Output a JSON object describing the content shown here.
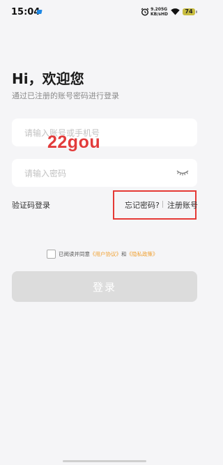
{
  "status_bar": {
    "time": "15:04",
    "net_speed_value": "9.20",
    "net_speed_unit": "KB/s",
    "net_type_top": "5G",
    "net_type_bottom": "HD",
    "battery": "74",
    "battery_color": "#c7bc40",
    "icons": [
      "app-notification-icon",
      "alarm-icon",
      "wifi-icon",
      "battery-icon"
    ]
  },
  "header": {
    "title": "Hi，欢迎您",
    "subtitle": "通过已注册的账号密码进行登录"
  },
  "form": {
    "account_placeholder": "请输入账号或手机号",
    "account_value": "",
    "password_placeholder": "请输入密码",
    "password_value": "",
    "password_toggle_icon": "eye-closed-icon"
  },
  "watermark": "22gou",
  "links": {
    "sms_login": "验证码登录",
    "forgot_password": "忘记密码?",
    "register": "注册账号"
  },
  "agreement": {
    "prefix": "已阅读并同意",
    "user_agreement": "《用户协议》",
    "and": "和",
    "privacy_policy": "《隐私政策》",
    "link_color": "#f0a030",
    "checked": false
  },
  "login_button": "登录",
  "colors": {
    "background": "#f5f5f7",
    "highlight_box": "#e53935",
    "watermark": "#e23b3b",
    "button_disabled": "#dcdcdc"
  }
}
